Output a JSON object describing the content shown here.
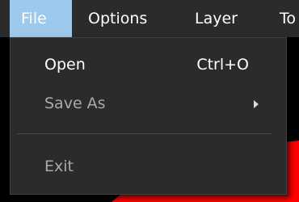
{
  "menubar": {
    "items": [
      {
        "label": "File",
        "active": true
      },
      {
        "label": "Options"
      },
      {
        "label": "Layer"
      },
      {
        "label": "To"
      }
    ]
  },
  "file_menu": {
    "open": {
      "label": "Open",
      "shortcut": "Ctrl+O",
      "enabled": true
    },
    "save_as": {
      "label": "Save As",
      "has_submenu": true,
      "enabled": false
    },
    "exit": {
      "label": "Exit",
      "enabled": false
    }
  },
  "colors": {
    "menu_bg": "#2b2b2b",
    "active_item_bg": "#9cc9ec",
    "canvas_bg": "#000000",
    "shape_fill": "#ff0000"
  }
}
